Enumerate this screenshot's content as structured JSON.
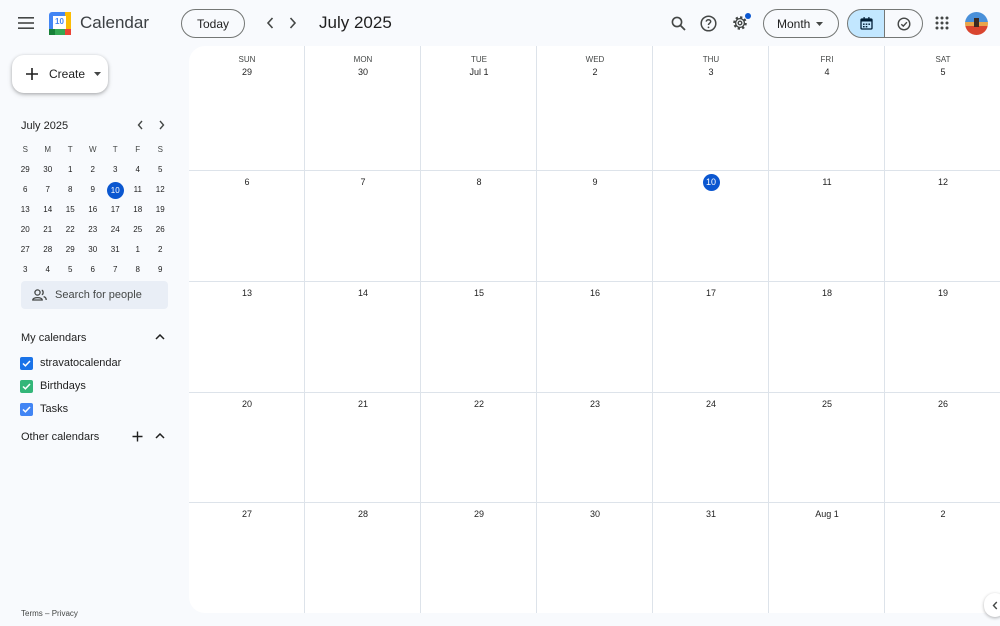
{
  "header": {
    "app_title": "Calendar",
    "logo_day": "10",
    "today_label": "Today",
    "month_title": "July 2025",
    "view_label": "Month"
  },
  "icons": {
    "menu": "hamburger-menu-icon",
    "prev": "chevron-left-icon",
    "next": "chevron-right-icon",
    "search": "search-icon",
    "help": "help-icon",
    "settings": "gear-icon",
    "calendar_view": "calendar-icon",
    "tasks_view": "check-circle-icon",
    "apps": "apps-grid-icon"
  },
  "sidebar": {
    "create_label": "Create",
    "mini_title": "July 2025",
    "mini_headers": [
      "S",
      "M",
      "T",
      "W",
      "T",
      "F",
      "S"
    ],
    "mini_weeks": [
      [
        "29",
        "30",
        "1",
        "2",
        "3",
        "4",
        "5"
      ],
      [
        "6",
        "7",
        "8",
        "9",
        "10",
        "11",
        "12"
      ],
      [
        "13",
        "14",
        "15",
        "16",
        "17",
        "18",
        "19"
      ],
      [
        "20",
        "21",
        "22",
        "23",
        "24",
        "25",
        "26"
      ],
      [
        "27",
        "28",
        "29",
        "30",
        "31",
        "1",
        "2"
      ],
      [
        "3",
        "4",
        "5",
        "6",
        "7",
        "8",
        "9"
      ]
    ],
    "search_people_placeholder": "Search for people",
    "my_calendars_title": "My calendars",
    "my_calendars": [
      {
        "label": "stravatocalendar",
        "color": "#1a73e8"
      },
      {
        "label": "Birthdays",
        "color": "#33b679"
      },
      {
        "label": "Tasks",
        "color": "#4285f4"
      }
    ],
    "other_calendars_title": "Other calendars",
    "footer_terms": "Terms",
    "footer_sep": "–",
    "footer_privacy": "Privacy"
  },
  "grid": {
    "day_headers": [
      "SUN",
      "MON",
      "TUE",
      "WED",
      "THU",
      "FRI",
      "SAT"
    ],
    "weeks": [
      [
        "29",
        "30",
        "Jul 1",
        "2",
        "3",
        "4",
        "5"
      ],
      [
        "6",
        "7",
        "8",
        "9",
        "10",
        "11",
        "12"
      ],
      [
        "13",
        "14",
        "15",
        "16",
        "17",
        "18",
        "19"
      ],
      [
        "20",
        "21",
        "22",
        "23",
        "24",
        "25",
        "26"
      ],
      [
        "27",
        "28",
        "29",
        "30",
        "31",
        "Aug 1",
        "2"
      ]
    ],
    "today": "10"
  },
  "colors": {
    "accent": "#0b57d0",
    "selected_view_bg": "#c2e7ff",
    "page_bg": "#f8fafd"
  }
}
